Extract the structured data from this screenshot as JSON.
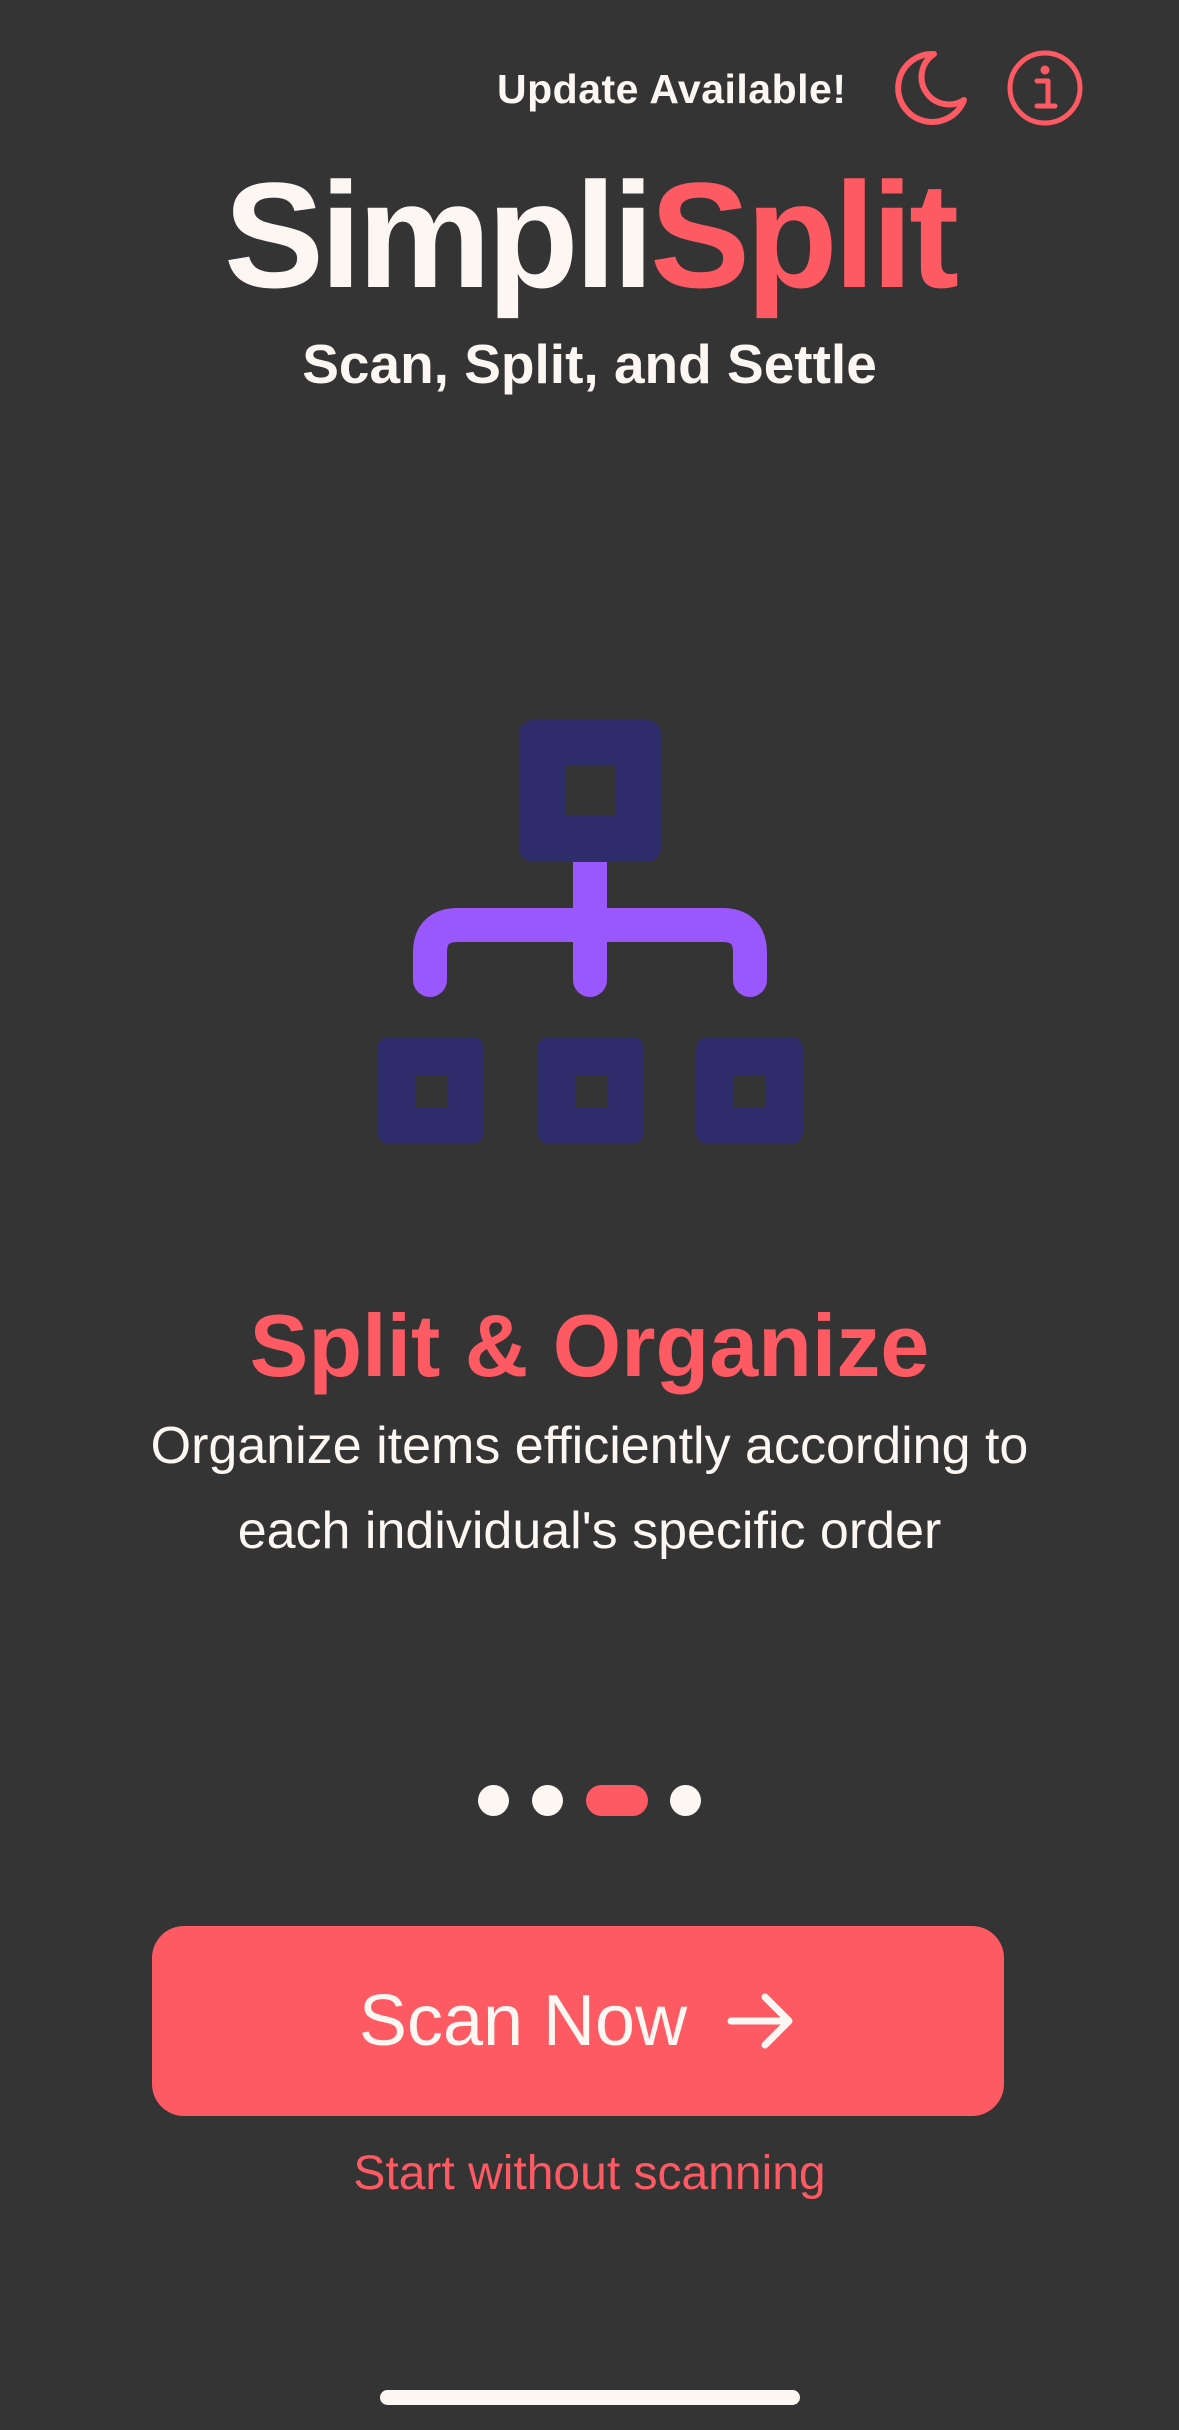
{
  "header": {
    "update_label": "Update Available!",
    "moon_icon": "moon-icon",
    "info_icon": "info-icon"
  },
  "brand": {
    "title_part1": "Simpli",
    "title_part2": "Split",
    "tagline": "Scan, Split, and Settle"
  },
  "slide": {
    "icon": "hierarchy-icon",
    "title": "Split & Organize",
    "description": "Organize items efficiently according to each individual's specific order"
  },
  "pagination": {
    "total": 4,
    "active_index": 2
  },
  "actions": {
    "scan_label": "Scan Now",
    "scan_icon": "arrow-right-icon",
    "start_label": "Start without scanning"
  },
  "colors": {
    "background": "#353435",
    "accent": "#fd5a64",
    "text": "#fdf7f3",
    "icon_boxes": "#2e2c6a",
    "icon_connector": "#9a57fb"
  }
}
